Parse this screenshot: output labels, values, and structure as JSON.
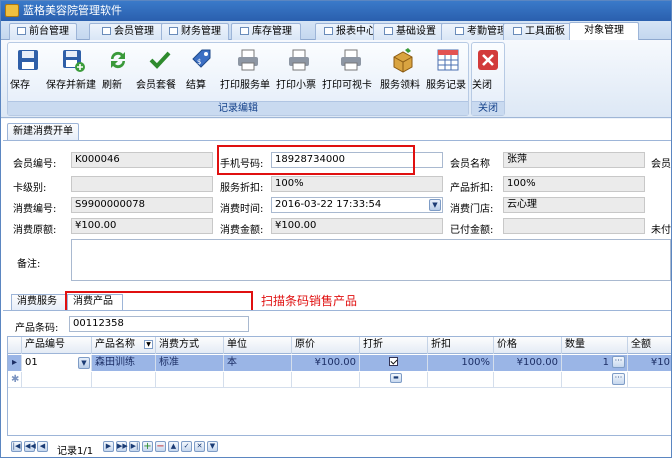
{
  "window": {
    "title": "蓝格美容院管理软件"
  },
  "tabs": [
    "前台管理",
    "会员管理",
    "财务管理",
    "库存管理",
    "报表中心",
    "基础设置",
    "考勤管理",
    "工具面板",
    "对象管理"
  ],
  "ribbon": {
    "buttons": [
      "保存",
      "保存并新建",
      "刷新",
      "会员套餐",
      "结算",
      "打印服务单",
      "打印小票",
      "打印可视卡",
      "服务领料",
      "服务记录"
    ],
    "group_label": "记录编辑",
    "close_label": "关闭",
    "close_group_label": "关闭"
  },
  "subtab": "新建消费开单",
  "form": {
    "member_no_label": "会员编号:",
    "member_no": "K000046",
    "phone_label": "手机号码:",
    "phone": "18928734000",
    "member_name_label": "会员名称",
    "member_name": "张萍",
    "member_cut_label": "会员",
    "card_level_label": "卡级别:",
    "card_level": "",
    "service_discount_label": "服务折扣:",
    "service_discount": "100%",
    "product_discount_label": "产品折扣:",
    "product_discount": "100%",
    "consume_no_label": "消费编号:",
    "consume_no": "S9900000078",
    "consume_time_label": "消费时间:",
    "consume_time": "2016-03-22 17:33:54",
    "store_label": "消费门店:",
    "store": "云心理",
    "original_amount_label": "消费原额:",
    "original_amount": "¥100.00",
    "amount_label": "消费金额:",
    "amount": "¥100.00",
    "paid_label": "已付金额:",
    "paid": "",
    "unpaid_cut_label": "未付",
    "remark_label": "备注:",
    "remark": ""
  },
  "tabs2": {
    "service": "消费服务",
    "product": "消费产品"
  },
  "barcode": {
    "label": "产品条码:",
    "value": "00112358"
  },
  "annotation": "扫描条码销售产品",
  "grid": {
    "headers": [
      "产品编号",
      "产品名称",
      "消费方式",
      "单位",
      "原价",
      "打折",
      "折扣",
      "价格",
      "数量",
      "全额"
    ],
    "rows": [
      {
        "code": "01",
        "name": "森田训练",
        "mode": "标准",
        "unit": "本",
        "orig": "¥100.00",
        "discounted": true,
        "rate": "100%",
        "price": "¥100.00",
        "qty": "1",
        "total": "¥10"
      }
    ]
  },
  "nav": {
    "record": "记录1/1"
  },
  "colors": {
    "accent": "#2a5fae",
    "highlight": "#e01010",
    "selected_row": "#9ab5e6"
  }
}
